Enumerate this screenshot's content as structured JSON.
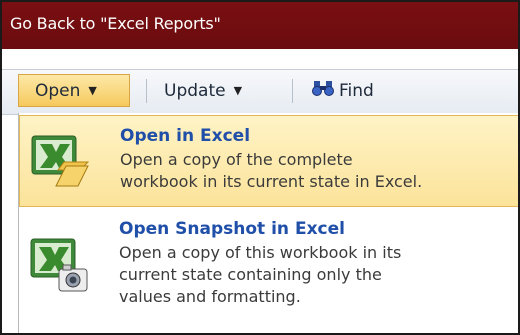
{
  "header": {
    "title": "Go Back to \"Excel Reports\""
  },
  "toolbar": {
    "open_label": "Open",
    "update_label": "Update",
    "find_label": "Find"
  },
  "menu": {
    "items": [
      {
        "title": "Open in Excel",
        "desc_lines": [
          "Open a copy of the complete",
          "workbook in its current state in Excel."
        ]
      },
      {
        "title": "Open Snapshot in Excel",
        "desc_lines": [
          "Open a copy of this workbook in its",
          "current state containing only the",
          "values and formatting."
        ]
      }
    ]
  },
  "icons": {
    "open": "excel-folder-icon",
    "snapshot": "excel-camera-icon",
    "find": "binoculars-icon"
  }
}
